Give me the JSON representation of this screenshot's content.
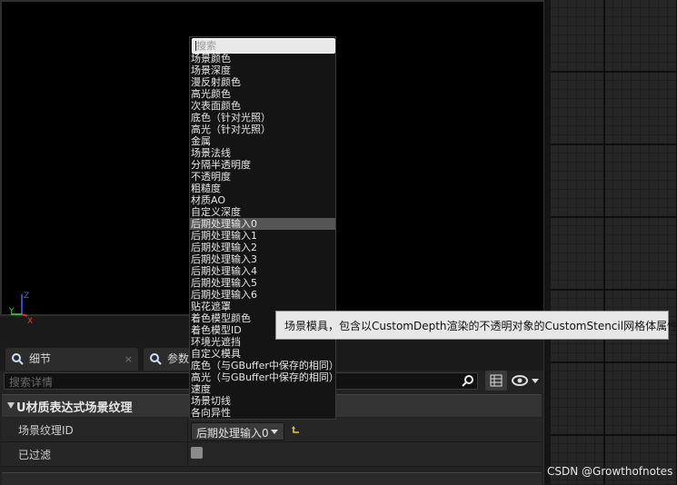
{
  "viewport": {
    "axis_z": "Z",
    "axis_y": "Y",
    "axis_x": "X"
  },
  "tabs": [
    {
      "label": "细节",
      "close": "×",
      "icon": "details-icon"
    },
    {
      "label": "参数",
      "icon": "search-icon"
    }
  ],
  "details": {
    "search_placeholder": "搜索详情",
    "category_title": "U材质表达式场景纹理",
    "rows": [
      {
        "key": "场景纹理ID",
        "value": "后期处理输入0"
      },
      {
        "key": "已过滤",
        "checked": true
      }
    ]
  },
  "dropdown": {
    "search_placeholder": "搜索",
    "selected_index": 14,
    "items": [
      "场景颜色",
      "场景深度",
      "漫反射颜色",
      "高光颜色",
      "次表面颜色",
      "底色（针对光照）",
      "高光（针对光照）",
      "金属",
      "场景法线",
      "分隔半透明度",
      "不透明度",
      "粗糙度",
      "材质AO",
      "自定义深度",
      "后期处理输入0",
      "后期处理输入1",
      "后期处理输入2",
      "后期处理输入3",
      "后期处理输入4",
      "后期处理输入5",
      "后期处理输入6",
      "贴花遮罩",
      "着色模型颜色",
      "着色模型ID",
      "环境光遮挡",
      "自定义模具",
      "底色（与GBuffer中保存的相同）",
      "高光（与GBuffer中保存的相同）",
      "速度",
      "场景切线",
      "各向异性"
    ]
  },
  "tooltip": {
    "text": "场景模具，包含以CustomDepth渲染的不透明对象的CustomStencil网格体属性"
  },
  "watermark": "CSDN @Growthofnotes",
  "colors": {
    "viewport_bg": "#000000",
    "panel_bg": "#222222",
    "selected_item": "#555555",
    "tooltip_bg": "#e7e7e7"
  }
}
